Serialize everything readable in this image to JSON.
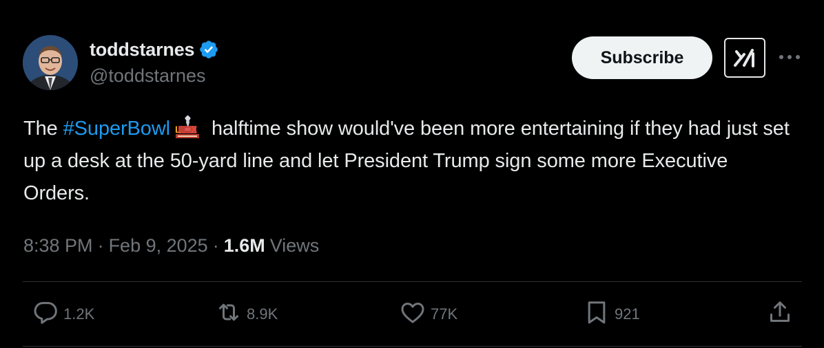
{
  "author": {
    "display_name": "toddstarnes",
    "handle": "@toddstarnes",
    "verified_icon": "verified-badge-icon",
    "avatar_icon": "avatar"
  },
  "header": {
    "subscribe_label": "Subscribe",
    "x_logo_icon": "x-logo-icon",
    "more_icon": "more-icon"
  },
  "tweet": {
    "text_before": "The ",
    "hashtag": "#SuperBowl",
    "hashtag_emoji_icon": "super-bowl-lix-icon",
    "text_after": " halftime show would've been more entertaining if they had just set up a desk at the 50-yard line and let President Trump sign some more Executive Orders."
  },
  "meta": {
    "time": "8:38 PM",
    "separator": "·",
    "date": "Feb 9, 2025",
    "views_count": "1.6M",
    "views_label": "Views"
  },
  "actions": {
    "replies": "1.2K",
    "reposts": "8.9K",
    "likes": "77K",
    "bookmarks": "921"
  },
  "colors": {
    "background": "#000000",
    "text": "#e7e9ea",
    "secondary": "#71767b",
    "link": "#1d9bf0",
    "verified": "#1d9bf0",
    "divider": "#2f3336",
    "subscribe_bg": "#eff3f4"
  }
}
